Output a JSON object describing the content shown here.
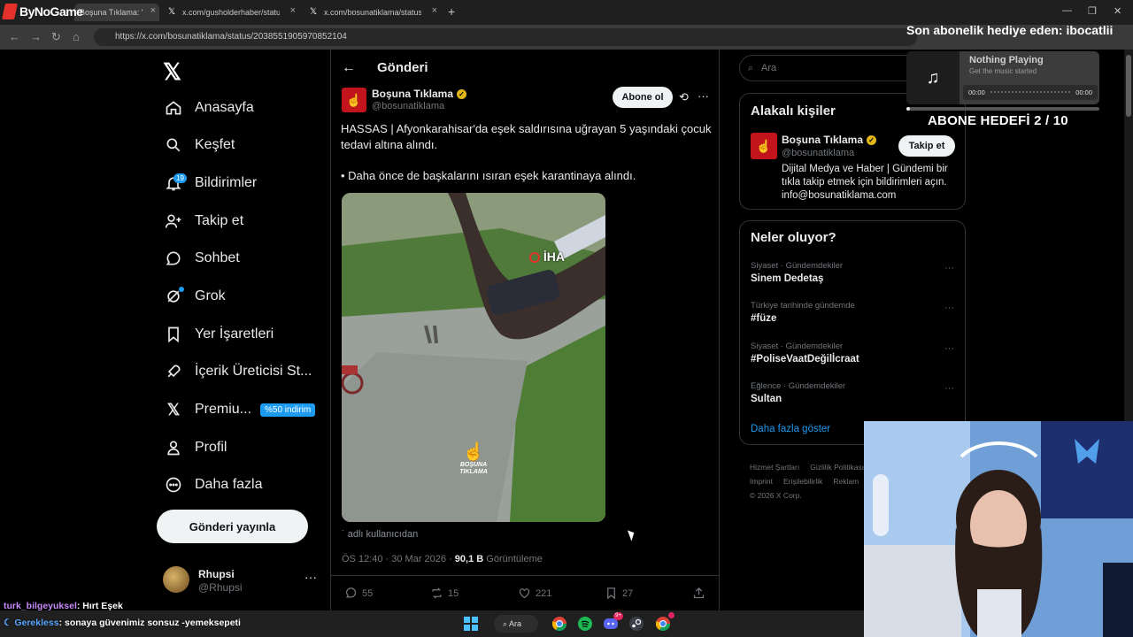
{
  "overlay": {
    "logo_text": "ByNoGame",
    "subscriber_gift": "Son abonelik hediye eden: ibocatlii",
    "subscriber_goal": "ABONE HEDEFİ 2 / 10"
  },
  "browser": {
    "tabs": [
      {
        "label": "Boşuna Tıklama: \"HASSA"
      },
      {
        "label": "x.com/gusholderhaber/status/2"
      },
      {
        "label": "x.com/bosunatiklama/status/20"
      }
    ],
    "url": "https://x.com/bosunatiklama/status/2038551905970852104"
  },
  "music": {
    "title": "Nothing Playing",
    "subtitle": "Get the music started",
    "time_start": "00:00",
    "time_end": "00:00",
    "progress": 0.02
  },
  "nav": {
    "items": [
      {
        "label": "Anasayfa",
        "icon": "home-icon"
      },
      {
        "label": "Keşfet",
        "icon": "search-icon"
      },
      {
        "label": "Bildirimler",
        "icon": "bell-icon",
        "badge": "19"
      },
      {
        "label": "Takip et",
        "icon": "follow-icon"
      },
      {
        "label": "Sohbet",
        "icon": "chat-icon"
      },
      {
        "label": "Grok",
        "icon": "grok-icon"
      },
      {
        "label": "Yer İşaretleri",
        "icon": "bookmark-icon"
      },
      {
        "label": "İçerik Üreticisi St...",
        "icon": "rocket-icon"
      },
      {
        "label": "Premiu...",
        "icon": "x-premium-icon",
        "promo": "%50 indirim"
      },
      {
        "label": "Profil",
        "icon": "profile-icon"
      },
      {
        "label": "Daha fazla",
        "icon": "more-circle-icon"
      }
    ],
    "post_button": "Gönderi yayınla",
    "account": {
      "name": "Rhupsi",
      "handle": "@Rhupsi"
    }
  },
  "post": {
    "header_title": "Gönderi",
    "author_name": "Boşuna Tıklama",
    "author_handle": "@bosunatiklama",
    "follow_label": "Abone ol",
    "text_1": "HASSAS | Afyonkarahisar'da eşek saldırısına uğrayan 5 yaşındaki çocuk tedavi altına alındı.",
    "text_2": "• Daha önce de başkalarını ısıran eşek karantinaya alındı.",
    "media_watermark_1": "İHA",
    "media_watermark_2": "BOŞUNA TIKLAMA",
    "media_caption": "˙ adlı kullanıcıdan",
    "time": "ÖS 12:40 · 30 Mar 2026 · ",
    "views": "90,1 B",
    "views_label": " Görüntüleme",
    "replies": "55",
    "reposts": "15",
    "likes": "221",
    "bookmarks": "27"
  },
  "sidebar": {
    "search_placeholder": "Ara",
    "related_title": "Alakalı kişiler",
    "related": {
      "name": "Boşuna Tıklama",
      "handle": "@bosunatiklama",
      "follow_label": "Takip et",
      "bio": "Dijital Medya ve Haber | Gündemi bir tıkla takip etmek için bildirimleri açın. info@bosunatiklama.com"
    },
    "trends_title": "Neler oluyor?",
    "trends": [
      {
        "category": "Siyaset · Gündemdekiler",
        "title": "Sinem Dedetaş"
      },
      {
        "category": "Türkiye tarihinde gündemde",
        "title": "#füze"
      },
      {
        "category": "Siyaset · Gündemdekiler",
        "title": "#PoliseVaatDeğilİcraat"
      },
      {
        "category": "Eğlence · Gündemdekiler",
        "title": "Sultan"
      }
    ],
    "show_more": "Daha fazla göster",
    "footer": {
      "terms": "Hizmet Şartları",
      "privacy": "Gizlilik Politikası",
      "imprint": "Imprint",
      "accessibility": "Erişilebilirlik",
      "ads": "Reklam",
      "copyright": "© 2026 X Corp."
    }
  },
  "chat": [
    {
      "user": "turk_bilgeyuksel",
      "message": ": Hırt Eşek"
    },
    {
      "user": "Gerekless",
      "message": ": sonaya güvenimiz sonsuz -yemeksepeti"
    }
  ],
  "taskbar": {
    "search_label": "Ara",
    "discord_badge": "9+"
  }
}
